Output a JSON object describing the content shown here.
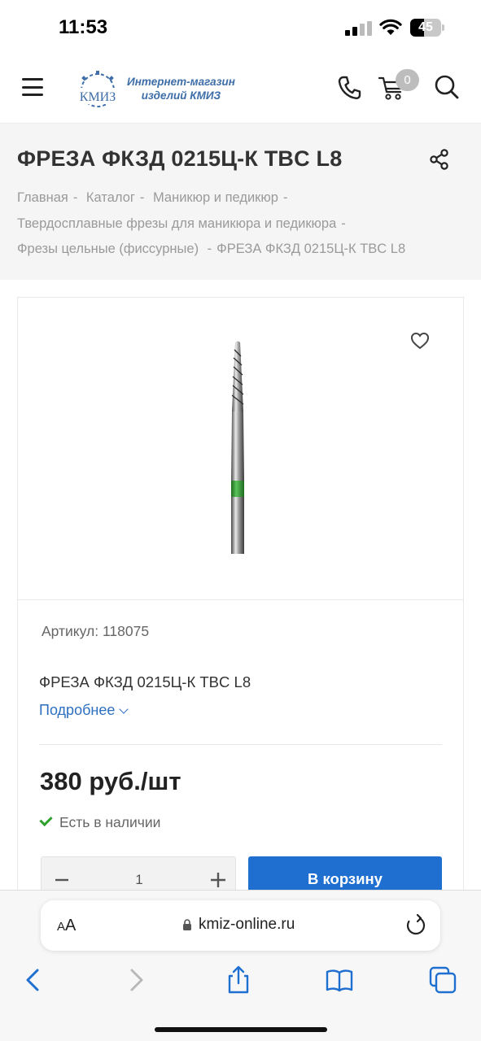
{
  "status_bar": {
    "time": "11:53",
    "battery": "45",
    "battery_level": 0.45
  },
  "header": {
    "logo_mark_text": "КМИЗ",
    "logo_line1": "Интернет-магазин",
    "logo_line2": "изделий КМИЗ",
    "cart_count": "0"
  },
  "product": {
    "title": "ФРЕЗА ФКЗД 0215Ц-К TBC L8",
    "breadcrumb": [
      "Главная",
      "Каталог",
      "Маникюр и педикюр",
      "Твердосплавные фрезы для маникюра и педикюра",
      "Фрезы цельные (фиссурные)",
      "ФРЕЗА ФКЗД 0215Ц-К TBC L8"
    ],
    "sku_label": "Артикул:",
    "sku_value": "118075",
    "name": "ФРЕЗА ФКЗД 0215Ц-К TBC L8",
    "more_label": "Подробнее",
    "price": "380 руб./шт",
    "stock": "Есть в наличии",
    "quantity": "1",
    "add_to_cart": "В корзину"
  },
  "browser": {
    "text_size_label": "AA",
    "url": "kmiz-online.ru"
  },
  "colors": {
    "accent_blue": "#1f6fd1",
    "link_blue": "#2d6fc1",
    "stock_green": "#2fa12f",
    "band_bg": "#f5f5f5",
    "logo_blue": "#3f6ea8"
  },
  "icons": [
    "menu-icon",
    "phone-icon",
    "cart-icon",
    "search-icon",
    "share-icon",
    "heart-icon",
    "check-icon",
    "minus-icon",
    "plus-icon",
    "lock-icon",
    "reload-icon",
    "back-icon",
    "forward-icon",
    "share-sheet-icon",
    "bookmarks-icon",
    "tabs-icon"
  ]
}
